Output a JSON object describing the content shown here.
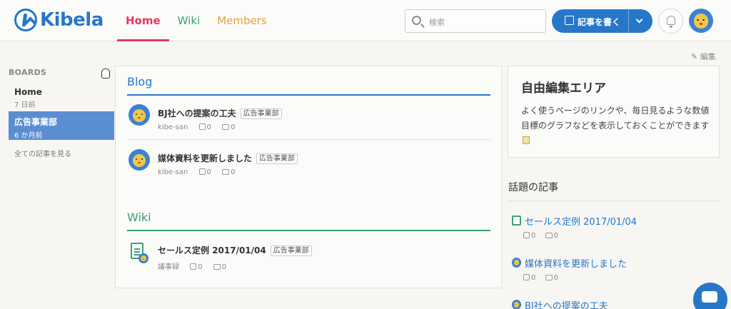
{
  "app": {
    "name": "Kibela"
  },
  "nav": {
    "home": "Home",
    "wiki": "Wiki",
    "members": "Members"
  },
  "search": {
    "placeholder": "検索"
  },
  "write_button": {
    "label": "記事を書く"
  },
  "edit_link": "編集",
  "sidebar": {
    "title": "BOARDS",
    "boards": [
      {
        "name": "Home",
        "time": "7 日前"
      },
      {
        "name": "広告事業部",
        "time": "6 か月前"
      }
    ],
    "all_articles": "全ての記事を見る"
  },
  "blog": {
    "title": "Blog",
    "posts": [
      {
        "title": "BJ社への提案の工夫",
        "tag": "広告事業部",
        "author": "kibe-san",
        "likes": "0",
        "comments": "0"
      },
      {
        "title": "媒体資料を更新しました",
        "tag": "広告事業部",
        "author": "kibe-san",
        "likes": "0",
        "comments": "0"
      }
    ]
  },
  "wiki": {
    "title": "Wiki",
    "posts": [
      {
        "title": "セールス定例 2017/01/04",
        "tag": "広告事業部",
        "author": "議事録",
        "likes": "0",
        "comments": "0"
      }
    ]
  },
  "free_area": {
    "title": "自由編集エリア",
    "body": "よく使うページのリンクや、毎日見るような数値目標のグラフなどを表示しておくことができます"
  },
  "popular": {
    "title": "話題の記事",
    "items": [
      {
        "title": "セールス定例 2017/01/04",
        "likes": "0",
        "comments": "0"
      },
      {
        "title": "媒体資料を更新しました",
        "likes": "0",
        "comments": "0"
      },
      {
        "title": "BJ社への提案の工夫"
      }
    ]
  },
  "colors": {
    "brand": "#2677c9",
    "home": "#e9365c",
    "wiki": "#3fa077",
    "members": "#e3a33b"
  }
}
